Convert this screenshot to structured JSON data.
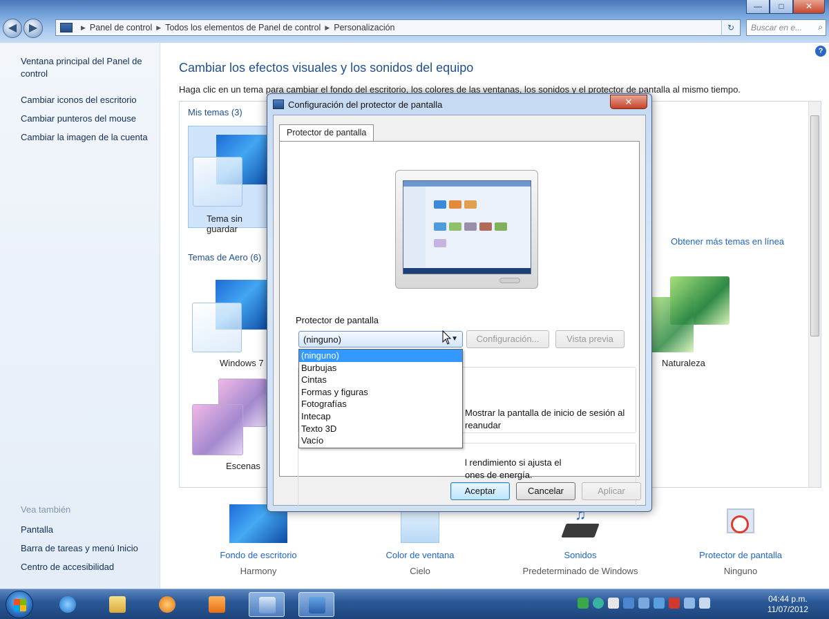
{
  "address": {
    "crumbs": [
      "Panel de control",
      "Todos los elementos de Panel de control",
      "Personalización"
    ],
    "search_placeholder": "Buscar en e..."
  },
  "window_controls": {
    "minimize": "—",
    "maximize": "□",
    "close": "✕"
  },
  "sidebar": {
    "links": [
      "Ventana principal del Panel de control",
      "Cambiar iconos del escritorio",
      "Cambiar punteros del mouse",
      "Cambiar la imagen de la cuenta"
    ],
    "see_also_title": "Vea también",
    "see_also": [
      "Pantalla",
      "Barra de tareas y menú Inicio",
      "Centro de accesibilidad"
    ]
  },
  "main": {
    "title": "Cambiar los efectos visuales y los sonidos del equipo",
    "description": "Haga clic en un tema para cambiar el fondo del escritorio, los colores de las ventanas, los sonidos y el protector de pantalla al mismo tiempo.",
    "my_themes": "Mis temas (3)",
    "aero_themes": "Temas de Aero (6)",
    "more_themes": "Obtener más temas en línea",
    "themes": {
      "unsaved": "Tema sin guardar",
      "win7": "Windows 7",
      "scenes": "Escenas",
      "nature": "Naturaleza"
    }
  },
  "bottom": [
    {
      "label": "Fondo de escritorio",
      "sub": "Harmony"
    },
    {
      "label": "Color de ventana",
      "sub": "Cielo"
    },
    {
      "label": "Sonidos",
      "sub": "Predeterminado de Windows"
    },
    {
      "label": "Protector de pantalla",
      "sub": "Ninguno"
    }
  ],
  "dialog": {
    "title": "Configuración del protector de pantalla",
    "tab": "Protector de pantalla",
    "group_title": "Protector de pantalla",
    "combo_value": "(ninguno)",
    "settings_button": "Configuración...",
    "preview_button": "Vista previa",
    "resume_text_1": "Mostrar la pantalla de inicio de sesión al",
    "resume_text_2": "reanudar",
    "power_text_1": "l rendimiento si ajusta el",
    "power_text_2": "ones de energía.",
    "options": [
      "(ninguno)",
      "Burbujas",
      "Cintas",
      "Formas y figuras",
      "Fotografías",
      "Intecap",
      "Texto 3D",
      "Vacío"
    ],
    "selected_option": "(ninguno)",
    "ok": "Aceptar",
    "cancel": "Cancelar",
    "apply": "Aplicar",
    "close": "✕"
  },
  "taskbar": {
    "time": "04:44 p.m.",
    "date": "11/07/2012"
  },
  "colors": {
    "link": "#1e65c8",
    "heading": "#1e4f8f",
    "selection": "#3399ff"
  }
}
